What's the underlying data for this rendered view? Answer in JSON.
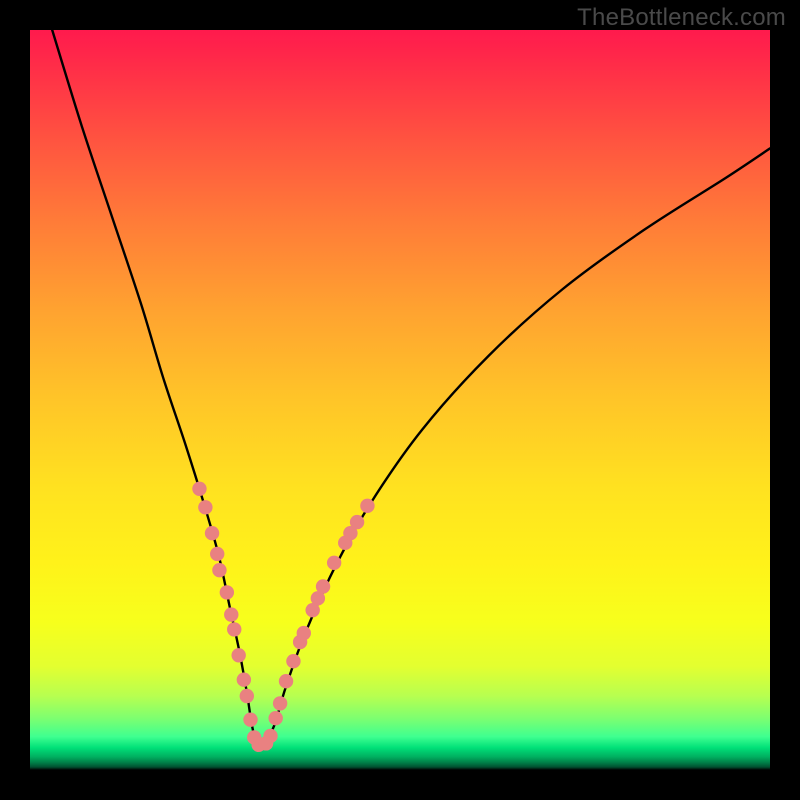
{
  "watermark": "TheBottleneck.com",
  "colors": {
    "frame": "#000000",
    "curve": "#000000",
    "marker_fill": "#e98181",
    "marker_stroke": "#d46a6a"
  },
  "chart_data": {
    "type": "line",
    "title": "",
    "xlabel": "",
    "ylabel": "",
    "xlim": [
      0,
      100
    ],
    "ylim": [
      0,
      100
    ],
    "note": "Values are approximate readings of the V-shaped curve in plot-relative percent coordinates (0,0 = top-left of colored plot area). Lower y = higher on image.",
    "x": [
      3,
      7,
      11,
      15,
      18,
      21,
      23.5,
      25.5,
      27,
      28.3,
      29.3,
      30,
      30.7,
      31.6,
      33,
      34.5,
      37,
      41,
      46,
      53,
      62,
      72,
      83,
      94,
      100
    ],
    "y": [
      0,
      13,
      25,
      37,
      47,
      56,
      64,
      71,
      78,
      84,
      89.5,
      94,
      96.5,
      96.5,
      94,
      89,
      82,
      73,
      64,
      54,
      44,
      35,
      27,
      20,
      16
    ],
    "series": [
      {
        "name": "curve",
        "role": "main-curve"
      }
    ],
    "markers": {
      "note": "Salmon dot clusters along both arms near the trough",
      "points": [
        {
          "x": 22.9,
          "y": 62.0
        },
        {
          "x": 23.7,
          "y": 64.5
        },
        {
          "x": 24.6,
          "y": 68.0
        },
        {
          "x": 25.3,
          "y": 70.8
        },
        {
          "x": 25.6,
          "y": 73.0
        },
        {
          "x": 26.6,
          "y": 76.0
        },
        {
          "x": 27.2,
          "y": 79.0
        },
        {
          "x": 27.6,
          "y": 81.0
        },
        {
          "x": 28.2,
          "y": 84.5
        },
        {
          "x": 28.9,
          "y": 87.8
        },
        {
          "x": 29.3,
          "y": 90.0
        },
        {
          "x": 29.8,
          "y": 93.2
        },
        {
          "x": 30.3,
          "y": 95.6
        },
        {
          "x": 30.9,
          "y": 96.6
        },
        {
          "x": 31.9,
          "y": 96.4
        },
        {
          "x": 32.5,
          "y": 95.4
        },
        {
          "x": 33.2,
          "y": 93.0
        },
        {
          "x": 33.8,
          "y": 91.0
        },
        {
          "x": 34.6,
          "y": 88.0
        },
        {
          "x": 35.6,
          "y": 85.3
        },
        {
          "x": 36.5,
          "y": 82.7
        },
        {
          "x": 37.0,
          "y": 81.5
        },
        {
          "x": 38.2,
          "y": 78.4
        },
        {
          "x": 38.9,
          "y": 76.8
        },
        {
          "x": 39.6,
          "y": 75.2
        },
        {
          "x": 41.1,
          "y": 72.0
        },
        {
          "x": 42.6,
          "y": 69.3
        },
        {
          "x": 43.3,
          "y": 68.0
        },
        {
          "x": 44.2,
          "y": 66.5
        },
        {
          "x": 45.6,
          "y": 64.3
        }
      ]
    }
  }
}
